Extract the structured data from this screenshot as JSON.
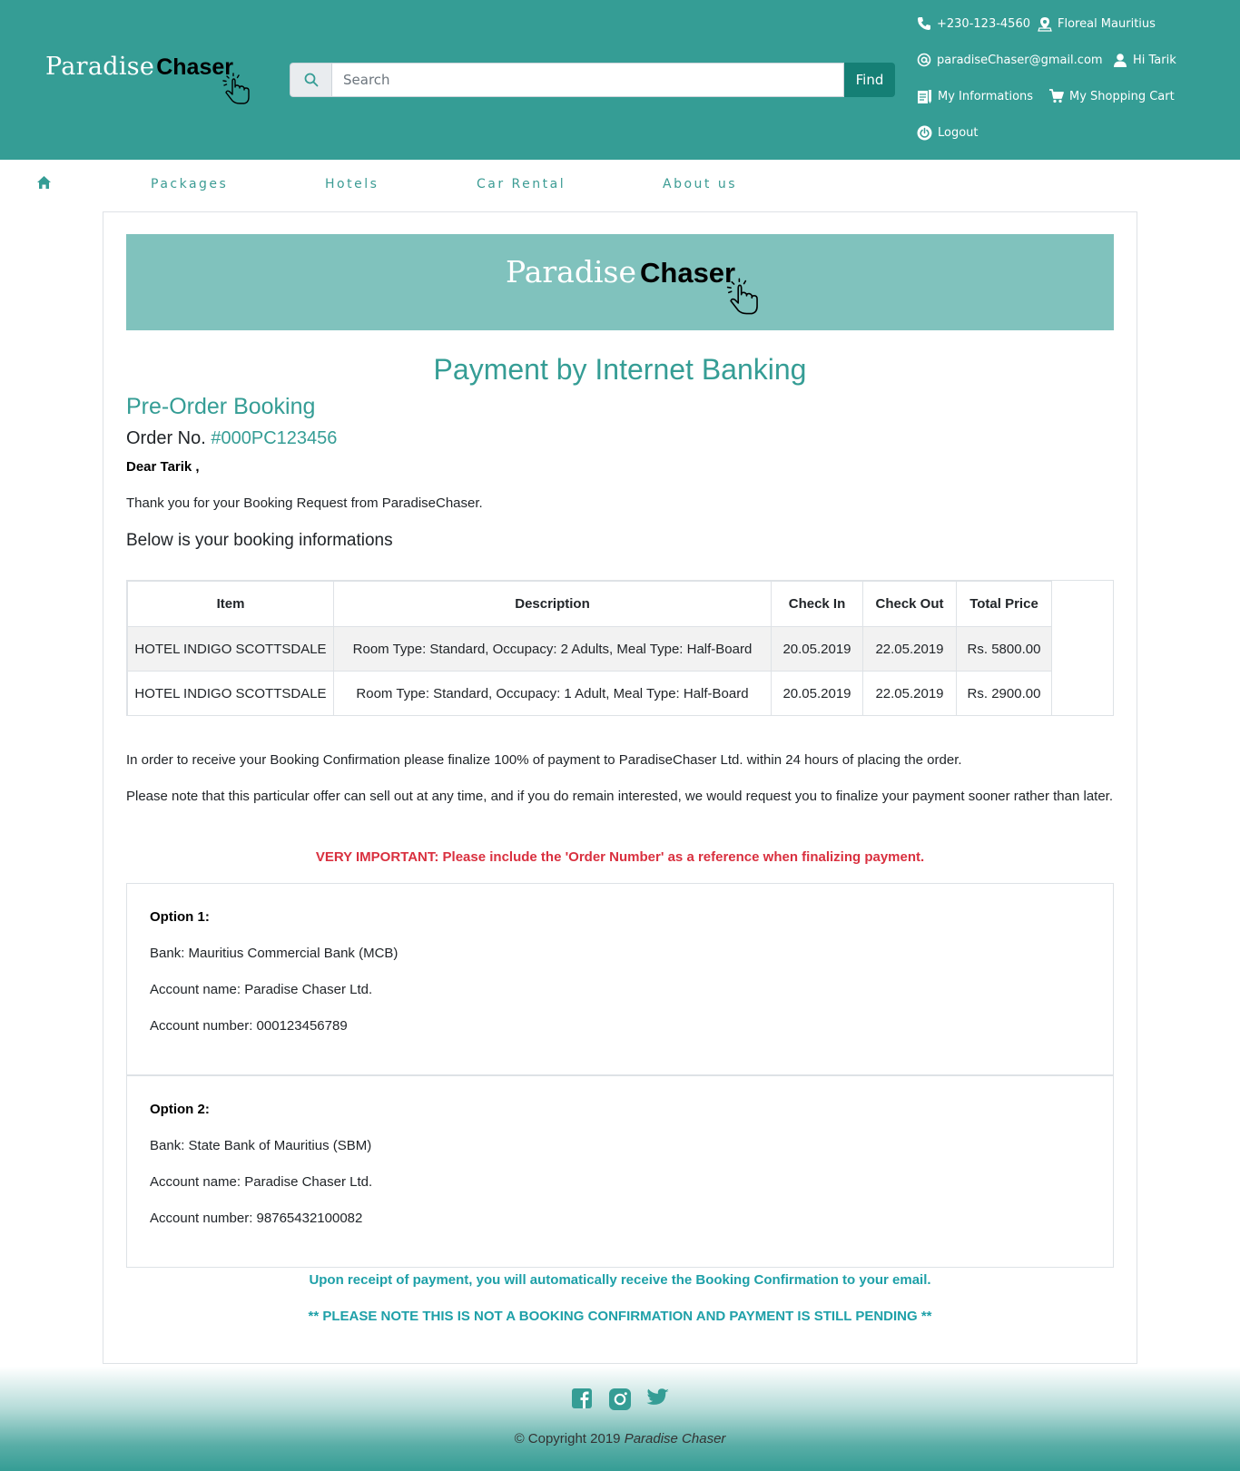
{
  "header": {
    "logo": {
      "word1": "Paradise",
      "word2": "Chaser"
    },
    "search": {
      "placeholder": "Search",
      "button": "Find"
    },
    "phone": "+230-123-4560",
    "location": "Floreal Mauritius",
    "email": "paradiseChaser@gmail.com",
    "greeting": "Hi Tarik",
    "my_info": "My Informations",
    "cart": "My Shopping Cart",
    "logout": "Logout"
  },
  "nav": {
    "items": [
      {
        "label": "Packages"
      },
      {
        "label": "Hotels"
      },
      {
        "label": "Car Rental"
      },
      {
        "label": "About us"
      }
    ]
  },
  "content": {
    "banner": {
      "word1": "Paradise",
      "word2": "Chaser"
    },
    "title": "Payment by Internet Banking",
    "subtitle": "Pre-Order Booking",
    "order_label": "Order No.",
    "order_number": "#000PC123456",
    "greeting": "Dear Tarik ,",
    "thanks": "Thank you for your Booking Request from ParadiseChaser.",
    "below": "Below is your booking informations",
    "table": {
      "headers": [
        "Item",
        "Description",
        "Check In",
        "Check Out",
        "Total Price"
      ],
      "rows": [
        [
          "HOTEL INDIGO SCOTTSDALE",
          "Room Type: Standard, Occupacy: 2 Adults, Meal Type: Half-Board",
          "20.05.2019",
          "22.05.2019",
          "Rs. 5800.00"
        ],
        [
          "HOTEL INDIGO SCOTTSDALE",
          "Room Type: Standard, Occupacy: 1 Adult, Meal Type: Half-Board",
          "20.05.2019",
          "22.05.2019",
          "Rs. 2900.00"
        ]
      ]
    },
    "para1": "In order to receive your Booking Confirmation please finalize 100% of payment to ParadiseChaser Ltd. within 24 hours of placing the order.",
    "para2": "Please note that this particular offer can sell out at any time, and if you do remain interested, we would request you to finalize your payment sooner rather than later.",
    "important": "VERY IMPORTANT: Please include the 'Order Number' as a reference when finalizing payment.",
    "options": [
      {
        "title": "Option 1:",
        "bank": "Bank: Mauritius Commercial Bank (MCB)",
        "name": "Account name: Paradise Chaser Ltd.",
        "number": "Account number: 000123456789"
      },
      {
        "title": "Option 2:",
        "bank": "Bank: State Bank of Mauritius (SBM)",
        "name": "Account name: Paradise Chaser Ltd.",
        "number": "Account number: 98765432100082"
      }
    ],
    "notice1": "Upon receipt of payment, you will automatically receive the Booking Confirmation to your email.",
    "notice2": "** PLEASE NOTE THIS IS NOT A BOOKING CONFIRMATION AND PAYMENT IS STILL PENDING **"
  },
  "footer": {
    "copyright_prefix": "© Copyright 2019",
    "copyright_brand": "Paradise Chaser"
  },
  "colors": {
    "primary": "#359d95",
    "banner": "#80c2bd",
    "find_button": "#157f75",
    "important": "#d9303f",
    "notice": "#1ea0a8"
  }
}
